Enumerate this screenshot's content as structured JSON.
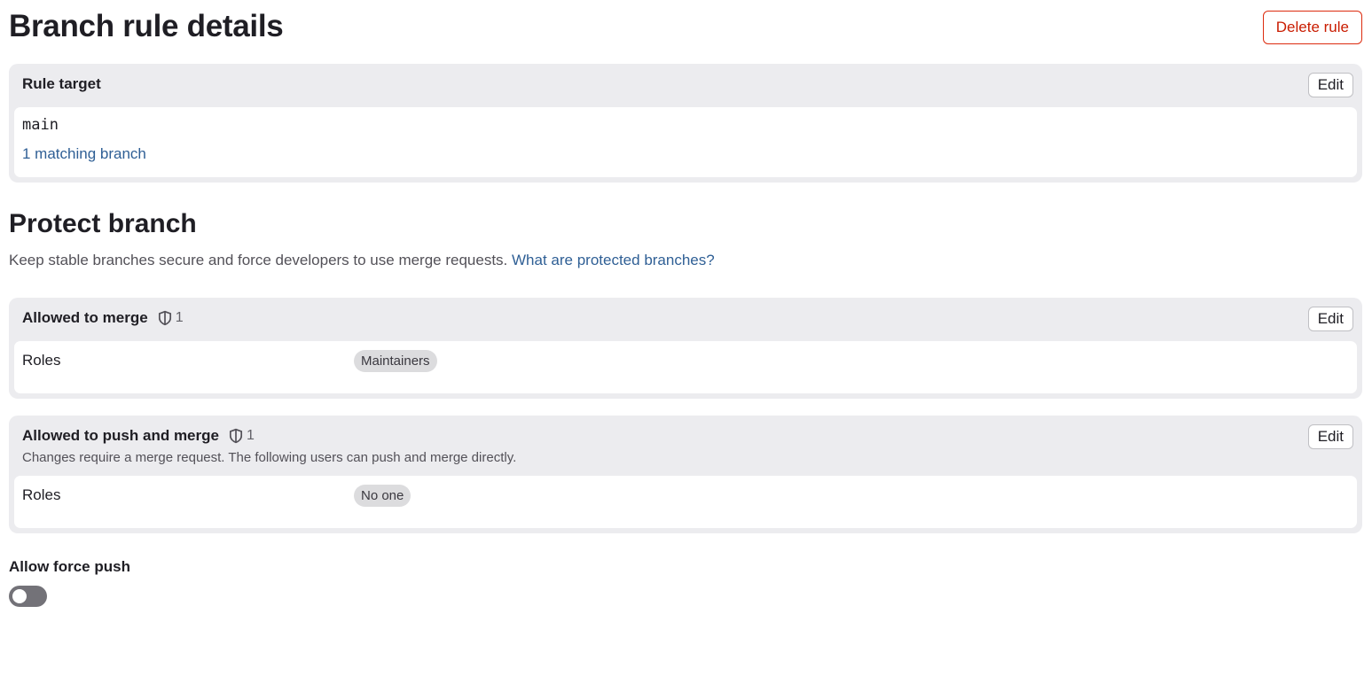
{
  "header": {
    "title": "Branch rule details",
    "delete_label": "Delete rule"
  },
  "rule_target": {
    "title": "Rule target",
    "edit_label": "Edit",
    "branch": "main",
    "matching_link": "1 matching branch"
  },
  "protect": {
    "title": "Protect branch",
    "description": "Keep stable branches secure and force developers to use merge requests.",
    "help_link": "What are protected branches?"
  },
  "allowed_to_merge": {
    "title": "Allowed to merge",
    "count": "1",
    "edit_label": "Edit",
    "roles_label": "Roles",
    "role": "Maintainers",
    "icon": "shield-icon"
  },
  "allowed_to_push": {
    "title": "Allowed to push and merge",
    "count": "1",
    "edit_label": "Edit",
    "subtitle": "Changes require a merge request. The following users can push and merge directly.",
    "roles_label": "Roles",
    "role": "No one",
    "icon": "shield-icon"
  },
  "force_push": {
    "label": "Allow force push",
    "enabled": false
  },
  "colors": {
    "danger": "#dd2b0e",
    "link": "#2f5f95",
    "card_bg": "#ececef",
    "toggle_off": "#737278"
  }
}
